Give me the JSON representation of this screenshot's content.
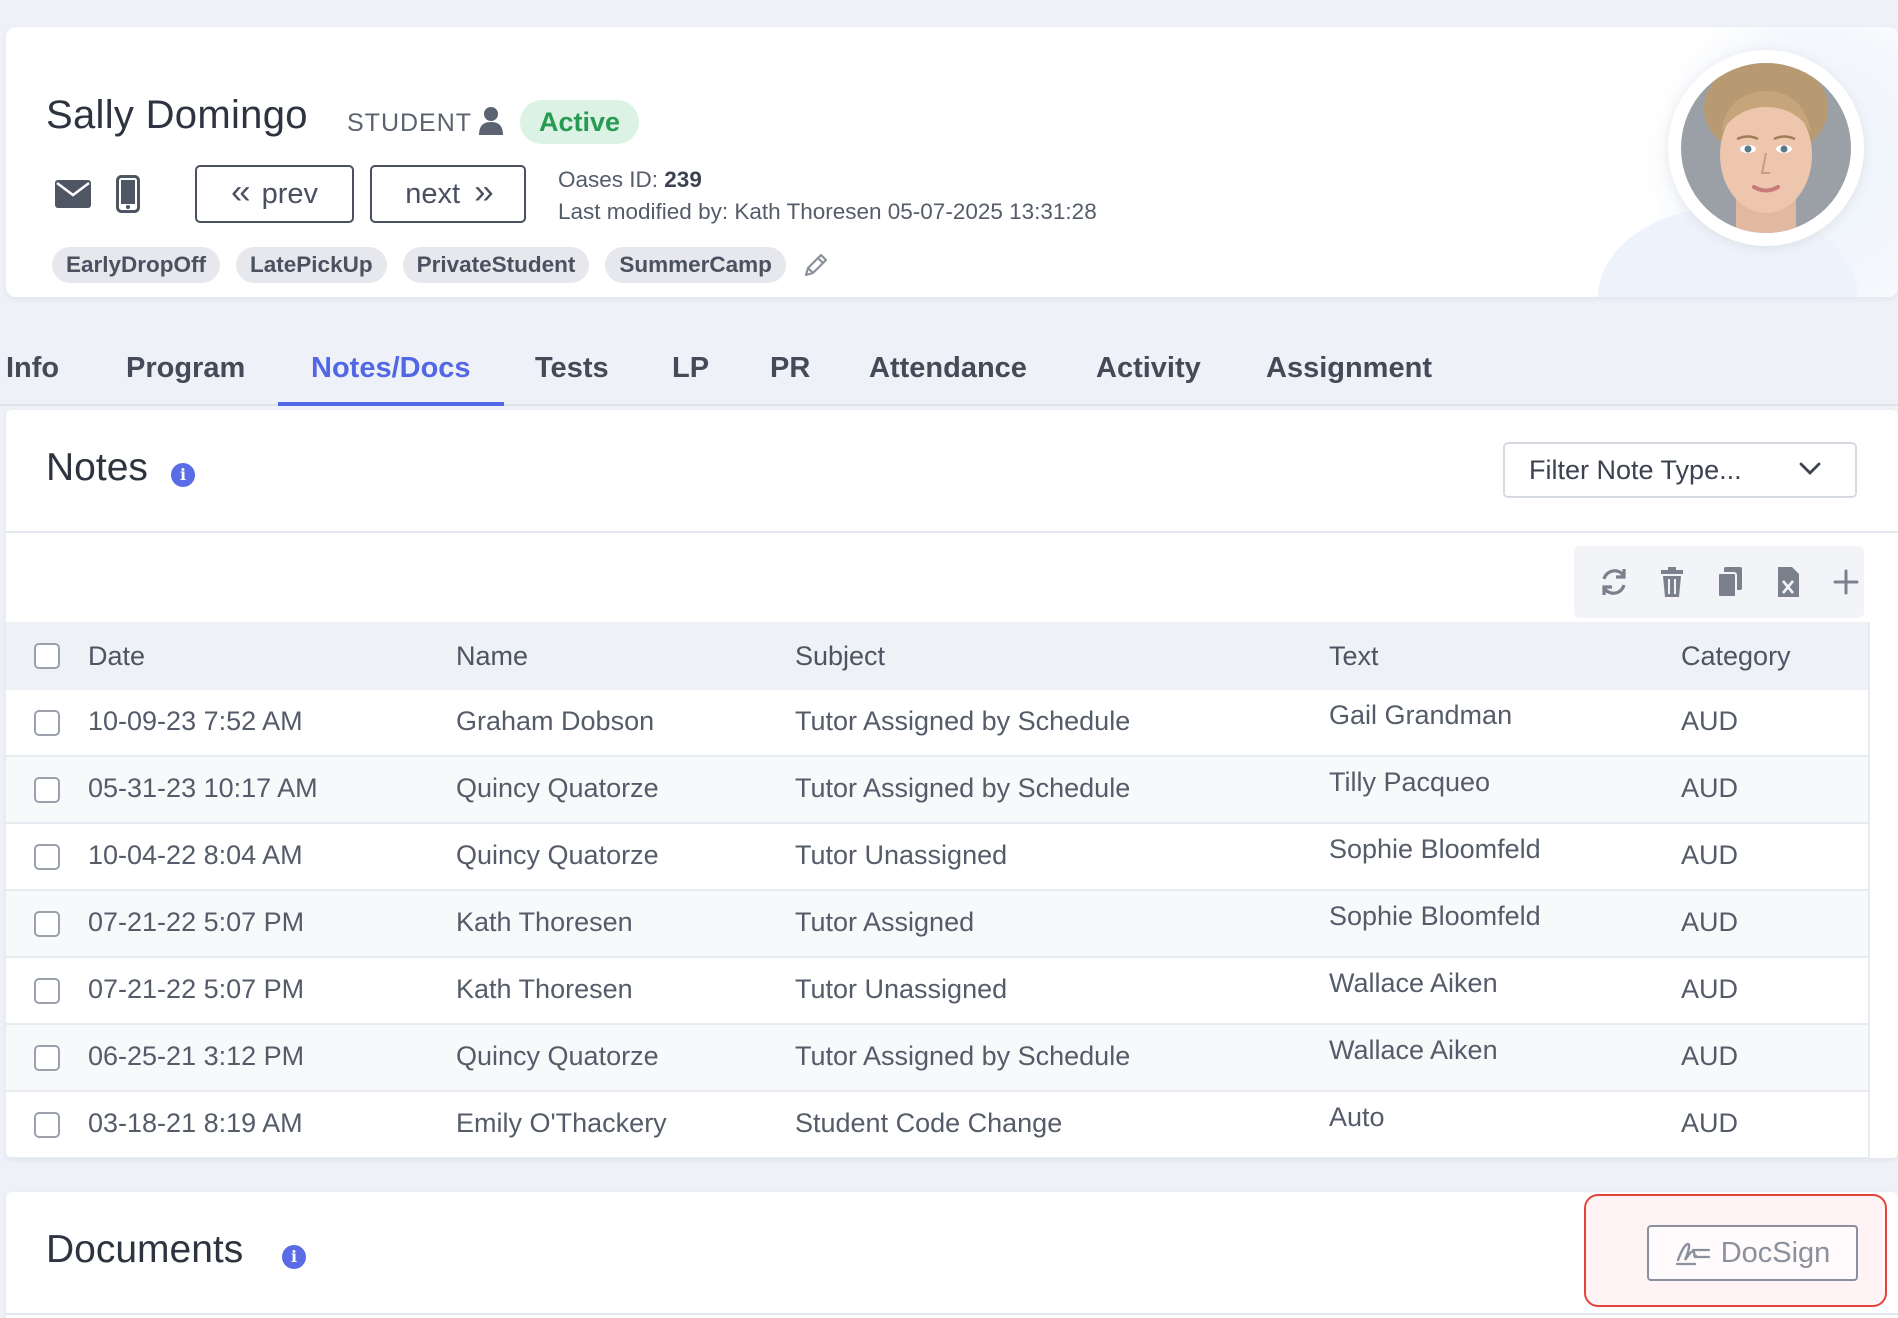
{
  "student": {
    "name": "Sally Domingo",
    "role": "STUDENT",
    "status": "Active",
    "oases_id_label": "Oases ID:",
    "oases_id": "239",
    "last_modified": "Last modified by: Kath Thoresen 05-07-2025 13:31:28",
    "tags": [
      "EarlyDropOff",
      "LatePickUp",
      "PrivateStudent",
      "SummerCamp"
    ]
  },
  "nav": {
    "prev_label": "prev",
    "next_label": "next"
  },
  "tabs": [
    "Info",
    "Program",
    "Notes/Docs",
    "Tests",
    "LP",
    "PR",
    "Attendance",
    "Activity",
    "Assignment"
  ],
  "active_tab": "Notes/Docs",
  "notes": {
    "title": "Notes",
    "filter_placeholder": "Filter Note Type...",
    "columns": [
      "Date",
      "Name",
      "Subject",
      "Text",
      "Category"
    ],
    "rows": [
      [
        "10-09-23 7:52 AM",
        "Graham Dobson",
        "Tutor Assigned by Schedule",
        "Gail Grandman",
        "AUD"
      ],
      [
        "05-31-23 10:17 AM",
        "Quincy Quatorze",
        "Tutor Assigned by Schedule",
        "Tilly Pacqueo",
        "AUD"
      ],
      [
        "10-04-22 8:04 AM",
        "Quincy Quatorze",
        "Tutor Unassigned",
        "Sophie Bloomfeld",
        "AUD"
      ],
      [
        "07-21-22 5:07 PM",
        "Kath Thoresen",
        "Tutor Assigned",
        "Sophie Bloomfeld",
        "AUD"
      ],
      [
        "07-21-22 5:07 PM",
        "Kath Thoresen",
        "Tutor Unassigned",
        "Wallace Aiken",
        "AUD"
      ],
      [
        "06-25-21 3:12 PM",
        "Quincy Quatorze",
        "Tutor Assigned by Schedule",
        "Wallace Aiken",
        "AUD"
      ],
      [
        "03-18-21 8:19 AM",
        "Emily O'Thackery",
        "Student Code Change",
        "Auto",
        "AUD"
      ]
    ]
  },
  "documents": {
    "title": "Documents",
    "docsign_label": "DocSign"
  },
  "icons": {
    "info": "info-icon",
    "refresh": "refresh-icon",
    "delete": "trash-icon",
    "copy": "copy-icon",
    "excel": "excel-icon",
    "add": "plus-icon",
    "mail": "mail-icon",
    "phone": "phone-icon",
    "edit": "pencil-icon"
  },
  "colors": {
    "accent": "#5267e6",
    "status_green": "#279a53",
    "status_green_bg": "#dcf2e4",
    "highlight": "#e2453d"
  }
}
